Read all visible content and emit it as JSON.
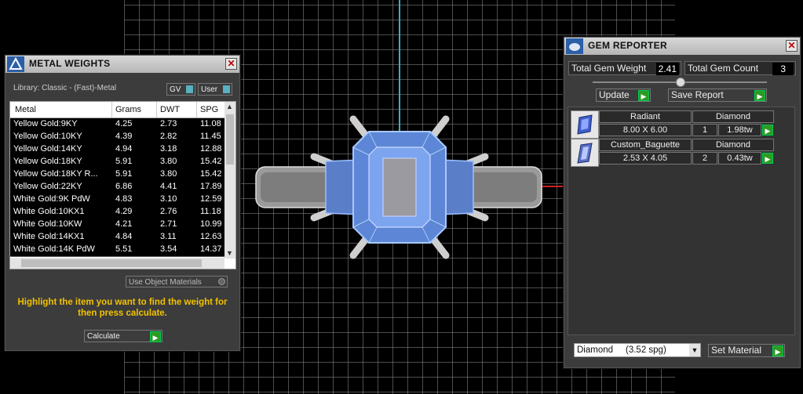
{
  "metal_weights": {
    "title": "METAL WEIGHTS",
    "library": "Library: Classic - (Fast)-Metal",
    "gv_label": "GV",
    "user_label": "User",
    "columns": [
      "Metal",
      "Grams",
      "DWT",
      "SPG"
    ],
    "rows": [
      [
        "Yellow Gold:9KY",
        "4.25",
        "2.73",
        "11.08"
      ],
      [
        "Yellow Gold:10KY",
        "4.39",
        "2.82",
        "11.45"
      ],
      [
        "Yellow Gold:14KY",
        "4.94",
        "3.18",
        "12.88"
      ],
      [
        "Yellow Gold:18KY",
        "5.91",
        "3.80",
        "15.42"
      ],
      [
        "Yellow Gold:18KY R...",
        "5.91",
        "3.80",
        "15.42"
      ],
      [
        "Yellow Gold:22KY",
        "6.86",
        "4.41",
        "17.89"
      ],
      [
        "White Gold:9K PdW",
        "4.83",
        "3.10",
        "12.59"
      ],
      [
        "White Gold:10KX1",
        "4.29",
        "2.76",
        "11.18"
      ],
      [
        "White Gold:10KW",
        "4.21",
        "2.71",
        "10.99"
      ],
      [
        "White Gold:14KX1",
        "4.84",
        "3.11",
        "12.63"
      ],
      [
        "White Gold:14K PdW",
        "5.51",
        "3.54",
        "14.37"
      ]
    ],
    "use_object_materials": "Use Object Materials",
    "instruction": "Highlight the item you want to find the weight for then press calculate.",
    "calculate_label": "Calculate"
  },
  "gem_reporter": {
    "title": "GEM REPORTER",
    "total_weight_label": "Total Gem Weight",
    "total_weight_value": "2.41",
    "total_count_label": "Total Gem Count",
    "total_count_value": "3",
    "update_label": "Update",
    "save_report_label": "Save Report",
    "gems": [
      {
        "shape": "Radiant",
        "size": "8.00 X 6.00",
        "material": "Diamond",
        "count": "1",
        "weight": "1.98tw"
      },
      {
        "shape": "Custom_Baguette",
        "size": "2.53 X 4.05",
        "material": "Diamond",
        "count": "2",
        "weight": "0.43tw"
      }
    ],
    "material_select": "Diamond     (3.52 spg)",
    "set_material_label": "Set Material"
  },
  "icons": {
    "close": "close-icon",
    "go": "green-arrow-icon"
  },
  "colors": {
    "instruction_text": "#f2c200",
    "go_button": "#2e9a22",
    "axis_vertical": "#2ab3c8",
    "axis_horizontal": "#cc2222",
    "gem_highlight": "#7aa6ff"
  }
}
